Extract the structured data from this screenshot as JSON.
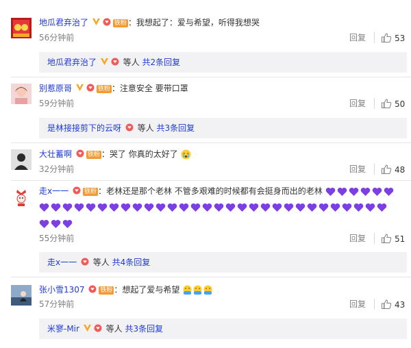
{
  "comments": [
    {
      "username": "地瓜君弃治了",
      "text": "我想起了：爱与希望，听得我想哭",
      "time": "56分钟前",
      "likes": "53",
      "sub": {
        "name": "地瓜君弃治了",
        "dengren": "等人",
        "more": "共2条回复"
      }
    },
    {
      "username": "别惹原哥",
      "text": "注意安全 要带口罩",
      "time": "59分钟前",
      "likes": "50",
      "sub": {
        "name": "是林接接剪下的云呀",
        "dengren": "等人",
        "more": "共3条回复"
      }
    },
    {
      "username": "大壮蓄啊",
      "text": "哭了 你真的太好了",
      "time": "32分钟前",
      "likes": "48"
    },
    {
      "username": "走x一一",
      "text": "老林还是那个老林 不管多艰难的时候都有会挺身而出的老林",
      "time": "55分钟前",
      "likes": "51",
      "sub": {
        "name": "走x一一",
        "dengren": "等人",
        "more": "共4条回复"
      }
    },
    {
      "username": "张小雪1307",
      "text": "想起了爱与希望",
      "time": "57分钟前",
      "likes": "43",
      "sub": {
        "name": "米寥-Mir",
        "dengren": "等人",
        "more": "共3条回复"
      }
    }
  ],
  "labels": {
    "reply": "回复",
    "colon": "：",
    "fan": "铁粉"
  },
  "icons": {
    "like": "thumbs-up-icon",
    "vip": "vip-v-icon",
    "heart": "purple-heart-icon",
    "cry": "crying-emoji-icon",
    "mask": "hug-emoji-icon"
  },
  "colors": {
    "username": "#eb7350",
    "link": "#1f3ad6",
    "heart": "#7b3fe4",
    "fan_badge": "#f29b33",
    "vip": "#f5a623"
  }
}
